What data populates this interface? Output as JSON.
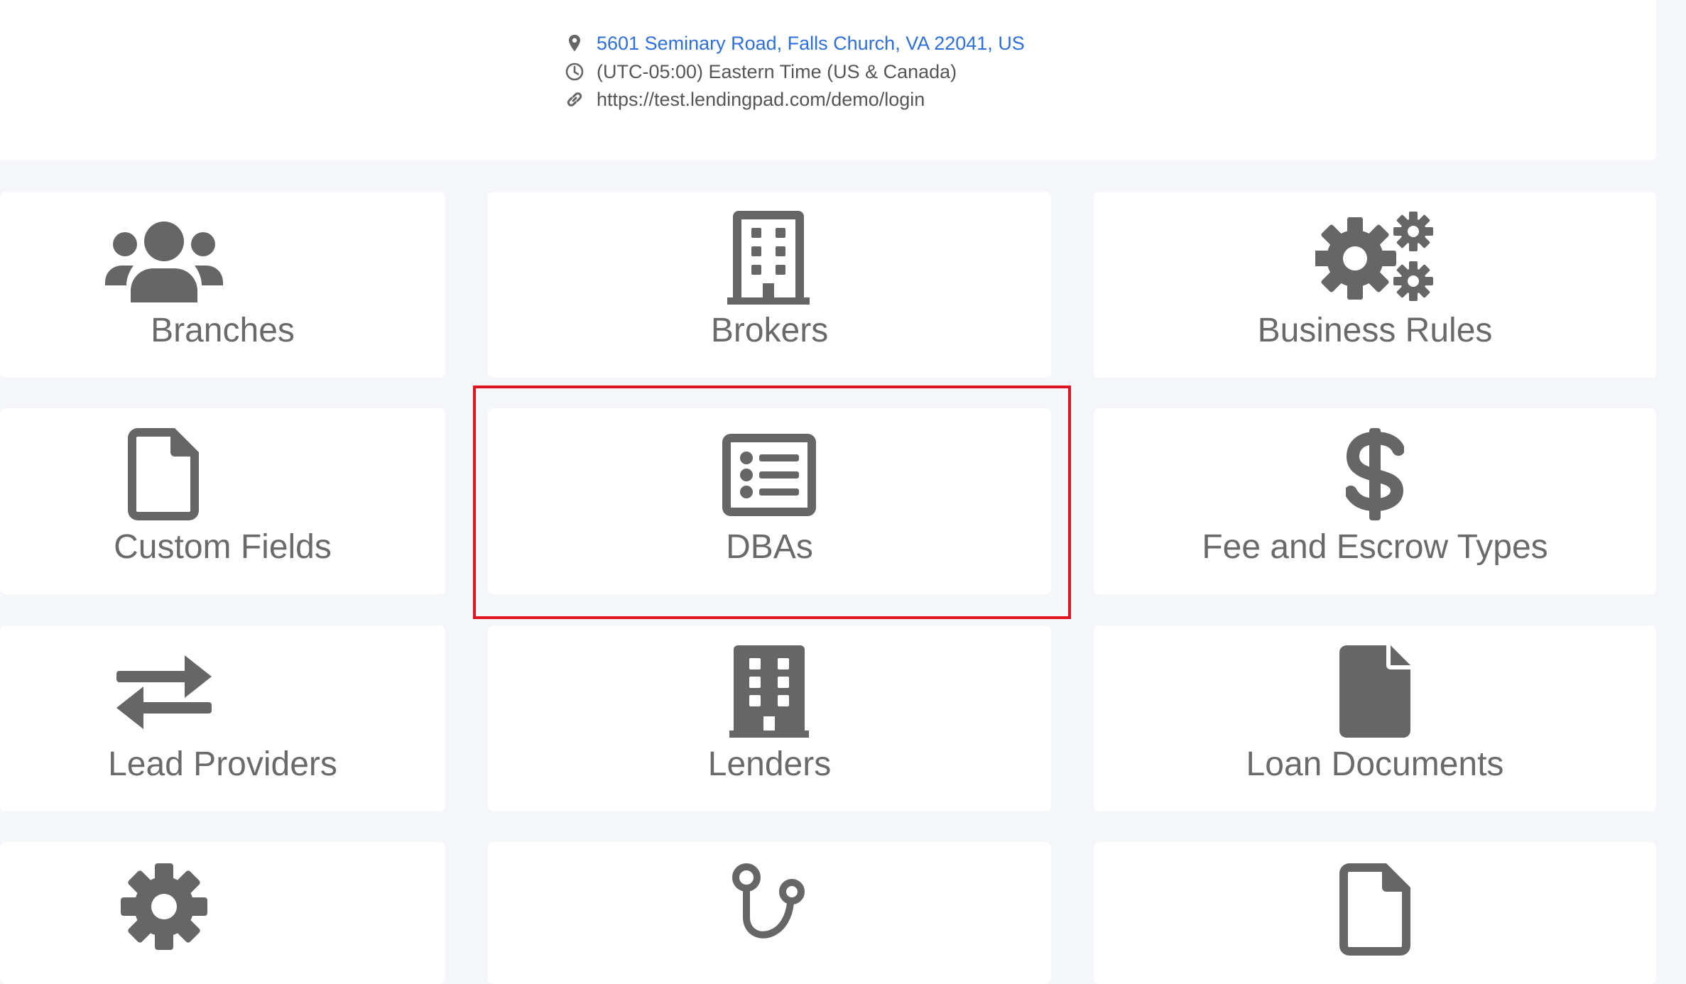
{
  "location": {
    "address": "5601 Seminary Road, Falls Church, VA 22041, US",
    "timezone": "(UTC-05:00) Eastern Time (US & Canada)",
    "url": "https://test.lendingpad.com/demo/login"
  },
  "tiles": [
    {
      "label": "Branches",
      "icon": "users-icon"
    },
    {
      "label": "Brokers",
      "icon": "building-outline-icon"
    },
    {
      "label": "Business Rules",
      "icon": "gears-icon"
    },
    {
      "label": "Custom Fields",
      "icon": "file-outline-icon"
    },
    {
      "label": "DBAs",
      "icon": "list-alt-icon"
    },
    {
      "label": "Fee and Escrow Types",
      "icon": "dollar-icon"
    },
    {
      "label": "Lead Providers",
      "icon": "exchange-icon"
    },
    {
      "label": "Lenders",
      "icon": "building-solid-icon"
    },
    {
      "label": "Loan Documents",
      "icon": "file-solid-icon"
    },
    {
      "label": "",
      "icon": "gear-icon"
    },
    {
      "label": "",
      "icon": "route-icon"
    },
    {
      "label": "",
      "icon": "file-outline-icon"
    }
  ],
  "colors": {
    "icon": "#666666",
    "address_link": "#2f6fdc",
    "highlight": "#e0141e",
    "background": "#f4f6f9"
  }
}
